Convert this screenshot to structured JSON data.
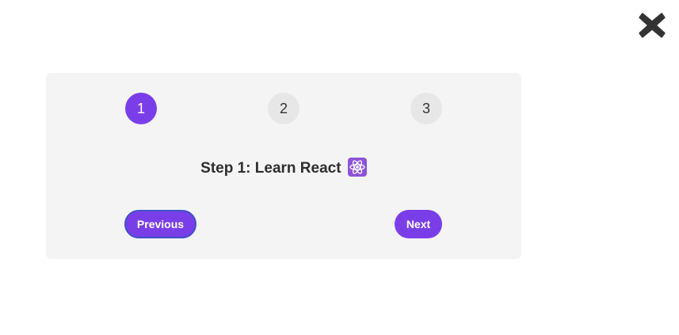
{
  "close": {
    "icon": "close-icon"
  },
  "steps": [
    {
      "label": "1",
      "active": true
    },
    {
      "label": "2",
      "active": false
    },
    {
      "label": "3",
      "active": false
    }
  ],
  "content": {
    "message": "Step 1: Learn React",
    "emoji_icon": "atom-icon"
  },
  "buttons": {
    "previous": "Previous",
    "next": "Next"
  },
  "colors": {
    "accent": "#7a3ee8",
    "inactive_step": "#e7e7e7",
    "card_background": "#f4f4f4"
  }
}
